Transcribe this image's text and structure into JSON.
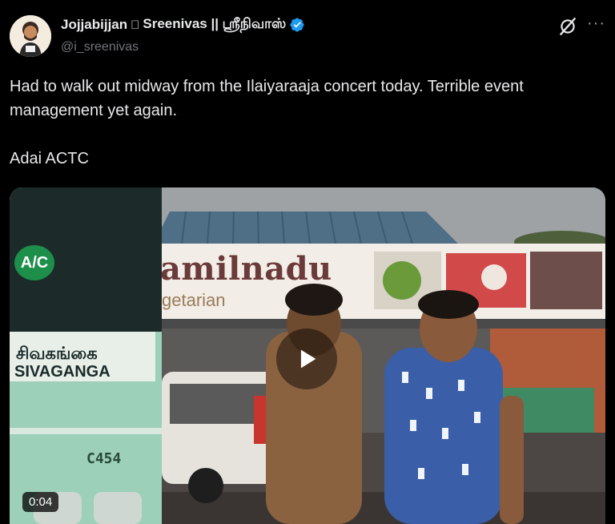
{
  "author": {
    "display_name": "Jojjabijjan",
    "apple_glyph": "",
    "display_name_2": "Sreenivas || ஸ்ரீநிவாஸ்",
    "handle": "@i_sreenivas",
    "verified_color": "#1d9bf0"
  },
  "tweet": {
    "text": "Had to walk out midway from the Ilaiyaraaja concert today. Terrible event management yet again.\n\nAdai ACTC"
  },
  "media": {
    "duration": "0:04",
    "scene_text": {
      "sign": "amilnadu",
      "sign_sub": "getarian",
      "bus_badge": "A/C",
      "bus_dest_tamil": "சிவகங்கை",
      "bus_dest": "SIVAGANGA",
      "bus_number": "C454"
    }
  },
  "icons": [
    "grok-icon",
    "more-icon",
    "verified-icon",
    "play-icon"
  ]
}
